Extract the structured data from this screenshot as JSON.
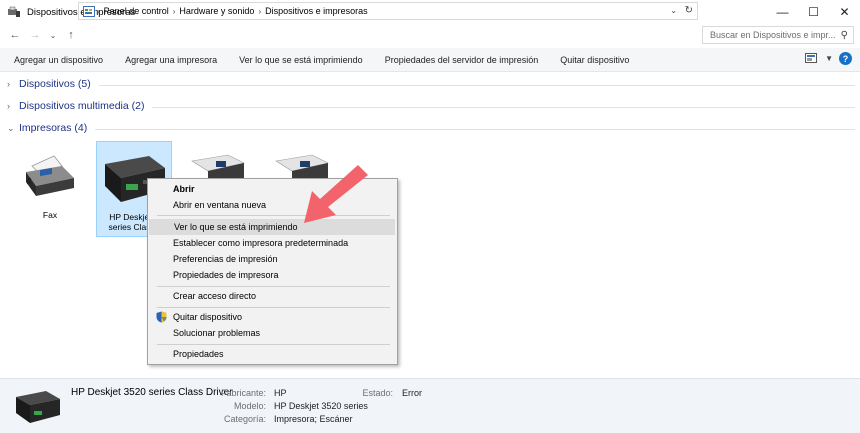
{
  "window": {
    "title": "Dispositivos e impresoras",
    "controls": {
      "minimize": "—",
      "maximize": "☐",
      "close": "✕"
    }
  },
  "address": {
    "crumbs": [
      "Panel de control",
      "Hardware y sonido",
      "Dispositivos e impresoras"
    ],
    "search_placeholder": "Buscar en Dispositivos e impr..."
  },
  "commands": [
    "Agregar un dispositivo",
    "Agregar una impresora",
    "Ver lo que se está imprimiendo",
    "Propiedades del servidor de impresión",
    "Quitar dispositivo"
  ],
  "groups": {
    "devices": "Dispositivos (5)",
    "multimedia": "Dispositivos multimedia (2)",
    "printers": "Impresoras (4)"
  },
  "printers": [
    {
      "label": "Fax"
    },
    {
      "label_line1": "HP Deskjet 3",
      "label_line2": "series Class I"
    }
  ],
  "context_menu": {
    "items": [
      {
        "label": "Abrir"
      },
      {
        "label": "Abrir en ventana nueva"
      },
      {
        "label": "Ver lo que se está imprimiendo"
      },
      {
        "label": "Establecer como impresora predeterminada"
      },
      {
        "label": "Preferencias de impresión"
      },
      {
        "label": "Propiedades de impresora"
      },
      {
        "label": "Crear acceso directo"
      },
      {
        "label": "Quitar dispositivo"
      },
      {
        "label": "Solucionar problemas"
      },
      {
        "label": "Propiedades"
      }
    ]
  },
  "details": {
    "name": "HP Deskjet 3520 series Class Driver",
    "fields": {
      "manufacturer_key": "Fabricante:",
      "manufacturer_val": "HP",
      "model_key": "Modelo:",
      "model_val": "HP Deskjet 3520 series",
      "category_key": "Categoría:",
      "category_val": "Impresora; Escáner",
      "status_key": "Estado:",
      "status_val": "Error"
    }
  },
  "colors": {
    "accent_group": "#1e3287",
    "selection": "#cce8ff",
    "arrow": "#f2636b"
  }
}
